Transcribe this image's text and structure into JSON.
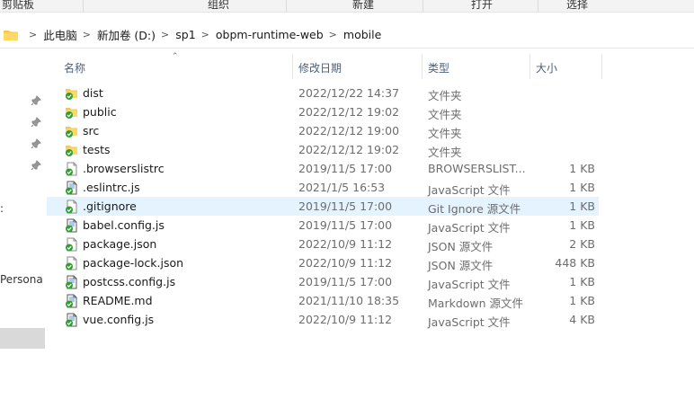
{
  "ribbon": {
    "groups": [
      "剪贴板",
      "组织",
      "新建",
      "打开",
      "选择"
    ]
  },
  "address": {
    "crumbs": [
      "此电脑",
      "新加卷 (D:)",
      "sp1",
      "obpm-runtime-web",
      "mobile"
    ]
  },
  "nav": {
    "partial_texts": [
      ":",
      "Persona"
    ]
  },
  "columns": {
    "name": "名称",
    "date": "修改日期",
    "type": "类型",
    "size": "大小"
  },
  "files": [
    {
      "name": "dist",
      "date": "2022/12/22 14:37",
      "type": "文件夹",
      "size": "",
      "icon": "folder-sync-icon"
    },
    {
      "name": "public",
      "date": "2022/12/12 19:02",
      "type": "文件夹",
      "size": "",
      "icon": "folder-sync-icon"
    },
    {
      "name": "src",
      "date": "2022/12/12 19:00",
      "type": "文件夹",
      "size": "",
      "icon": "folder-sync-icon"
    },
    {
      "name": "tests",
      "date": "2022/12/12 19:02",
      "type": "文件夹",
      "size": "",
      "icon": "folder-sync-icon"
    },
    {
      "name": ".browserslistrc",
      "date": "2019/11/5 17:00",
      "type": "BROWSERSLIST...",
      "size": "1 KB",
      "icon": "file-sync-icon"
    },
    {
      "name": ".eslintrc.js",
      "date": "2021/1/5 16:53",
      "type": "JavaScript 文件",
      "size": "1 KB",
      "icon": "js-file-sync-icon"
    },
    {
      "name": ".gitignore",
      "date": "2019/11/5 17:00",
      "type": "Git Ignore 源文件",
      "size": "1 KB",
      "icon": "file-sync-icon"
    },
    {
      "name": "babel.config.js",
      "date": "2019/11/5 17:00",
      "type": "JavaScript 文件",
      "size": "1 KB",
      "icon": "js-file-sync-icon"
    },
    {
      "name": "package.json",
      "date": "2022/10/9 11:12",
      "type": "JSON 源文件",
      "size": "2 KB",
      "icon": "file-sync-icon"
    },
    {
      "name": "package-lock.json",
      "date": "2022/10/9 11:12",
      "type": "JSON 源文件",
      "size": "448 KB",
      "icon": "file-sync-icon"
    },
    {
      "name": "postcss.config.js",
      "date": "2019/11/5 17:00",
      "type": "JavaScript 文件",
      "size": "1 KB",
      "icon": "js-file-sync-icon"
    },
    {
      "name": "README.md",
      "date": "2021/11/10 18:35",
      "type": "Markdown 源文件",
      "size": "1 KB",
      "icon": "js-file-sync-icon"
    },
    {
      "name": "vue.config.js",
      "date": "2022/10/9 11:12",
      "type": "JavaScript 文件",
      "size": "4 KB",
      "icon": "js-file-sync-icon"
    }
  ],
  "selected_index": 6,
  "colors": {
    "selection": "#e5f3ff",
    "sync_green": "#2e9e2e",
    "folder_yellow": "#f6c94a",
    "header_text": "#4c607a"
  }
}
